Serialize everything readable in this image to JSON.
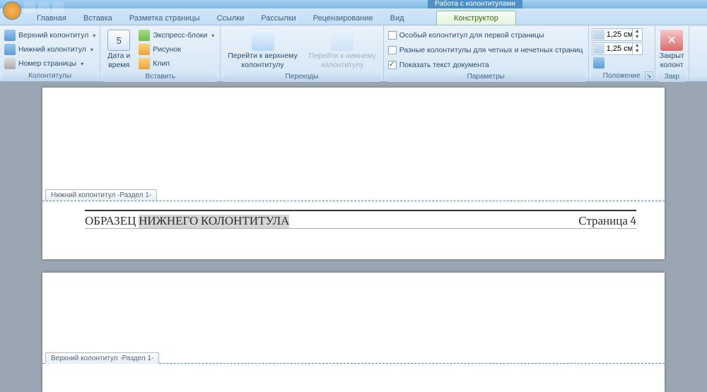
{
  "titlebar": {
    "contextual_title": "Работа с колонтитулами"
  },
  "tabs": {
    "home": "Главная",
    "insert": "Вставка",
    "page_layout": "Разметка страницы",
    "references": "Ссылки",
    "mailings": "Рассылки",
    "review": "Рецензирование",
    "view": "Вид",
    "design": "Конструктор"
  },
  "ribbon": {
    "group_headerfooter": {
      "label": "Колонтитулы",
      "header": "Верхний колонтитул",
      "footer": "Нижний колонтитул",
      "page_number": "Номер страницы"
    },
    "group_insert": {
      "label": "Вставить",
      "datetime_line1": "Дата и",
      "datetime_line2": "время",
      "quickparts": "Экспресс-блоки",
      "picture": "Рисунок",
      "clipart": "Клип"
    },
    "group_nav": {
      "label": "Переходы",
      "goto_header_l1": "Перейти к верхнему",
      "goto_header_l2": "колонтитулу",
      "goto_footer_l1": "Перейти к нижнему",
      "goto_footer_l2": "колонтитулу"
    },
    "group_options": {
      "label": "Параметры",
      "first_page": "Особый колонтитул для первой страницы",
      "odd_even": "Разные колонтитулы для четных и нечетных страниц",
      "show_doc": "Показать текст документа"
    },
    "group_position": {
      "label": "Положение",
      "top_value": "1,25 см",
      "bottom_value": "1,25 см"
    },
    "group_close": {
      "label": "Закр",
      "close_l1": "Закрыт",
      "close_l2": "колонт"
    }
  },
  "document": {
    "footer_tag": "Нижний колонтитул -Раздел 1-",
    "header_tag": "Верхний колонтитул -Раздел 1-",
    "footer_left_a": "ОБРАЗЕЦ",
    "footer_left_b": "НИЖНЕГО КОЛОНТИТУЛА",
    "footer_right": "Страница 4"
  }
}
